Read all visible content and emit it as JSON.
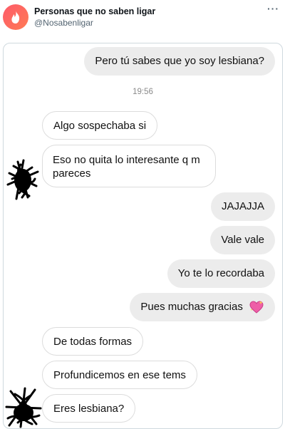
{
  "account": {
    "display_name": "Personas que no saben ligar",
    "handle": "@Nosabenligar",
    "more_label": "···"
  },
  "chat": {
    "timestamp": "19:56",
    "messages": [
      {
        "from": "me",
        "text": "Pero tú sabes que yo soy lesbiana?"
      },
      {
        "from": "them",
        "text": "Algo sospechaba si"
      },
      {
        "from": "them",
        "text": "Eso no quita lo interesante q m pareces"
      },
      {
        "from": "me",
        "text": "JAJAJJA"
      },
      {
        "from": "me",
        "text": "Vale vale"
      },
      {
        "from": "me",
        "text": "Yo te lo recordaba"
      },
      {
        "from": "me",
        "text": "Pues muchas gracias",
        "emoji": "sparkling-heart-icon"
      },
      {
        "from": "them",
        "text": "De todas formas"
      },
      {
        "from": "them",
        "text": "Profundicemos en ese tems"
      },
      {
        "from": "them",
        "text": "Eres lesbiana?"
      }
    ]
  },
  "colors": {
    "sent_bubble": "#ececec",
    "received_border": "#dcdcdc",
    "brand_gradient_start": "#fd5a6a",
    "brand_gradient_end": "#ff7b54"
  }
}
